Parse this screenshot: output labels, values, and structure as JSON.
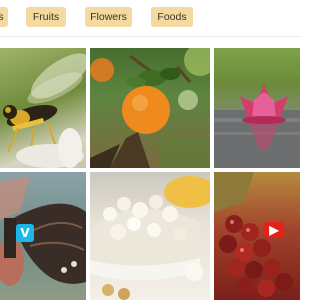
{
  "filters": {
    "partial_label": "s",
    "items": [
      {
        "label": "Fruits"
      },
      {
        "label": "Flowers"
      },
      {
        "label": "Foods"
      }
    ]
  },
  "badges": {
    "vimeo": "V",
    "youtube": "▶"
  }
}
